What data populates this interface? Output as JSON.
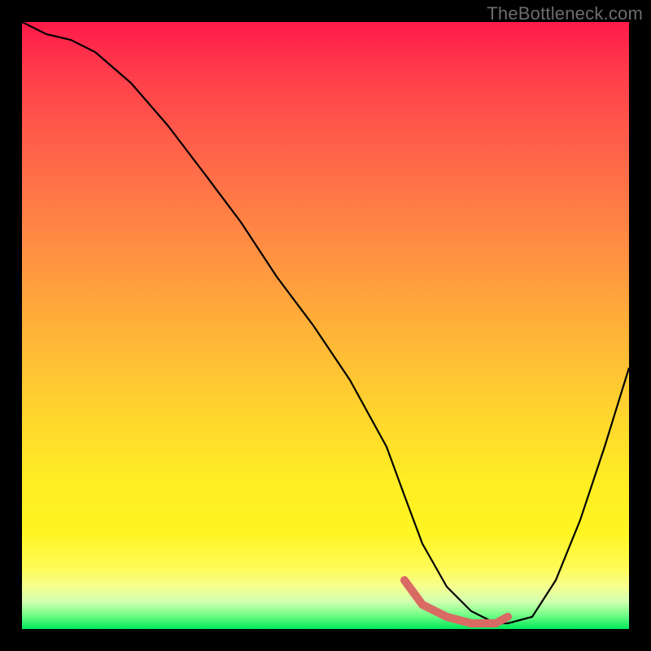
{
  "watermark": "TheBottleneck.com",
  "chart_data": {
    "type": "line",
    "title": "",
    "xlabel": "",
    "ylabel": "",
    "xlim": [
      0,
      100
    ],
    "ylim": [
      0,
      100
    ],
    "series": [
      {
        "name": "bottleneck-curve",
        "x": [
          0,
          4,
          8,
          12,
          18,
          24,
          30,
          36,
          42,
          48,
          54,
          60,
          63,
          66,
          70,
          74,
          78,
          80,
          84,
          88,
          92,
          96,
          100
        ],
        "y": [
          100,
          98,
          97,
          95,
          90,
          83,
          75,
          67,
          58,
          50,
          41,
          30,
          22,
          14,
          7,
          3,
          1,
          1,
          2,
          8,
          18,
          30,
          43
        ]
      }
    ],
    "highlight": {
      "name": "optimal-range",
      "x": [
        63,
        66,
        70,
        74,
        78,
        80
      ],
      "y": [
        8,
        4,
        2,
        1,
        1,
        2
      ],
      "color": "#d96a64"
    },
    "gradient_stops": [
      {
        "pos": 0.0,
        "color": "#ff1a49"
      },
      {
        "pos": 0.5,
        "color": "#ffbb36"
      },
      {
        "pos": 0.93,
        "color": "#f6ff90"
      },
      {
        "pos": 1.0,
        "color": "#00e85a"
      }
    ]
  }
}
